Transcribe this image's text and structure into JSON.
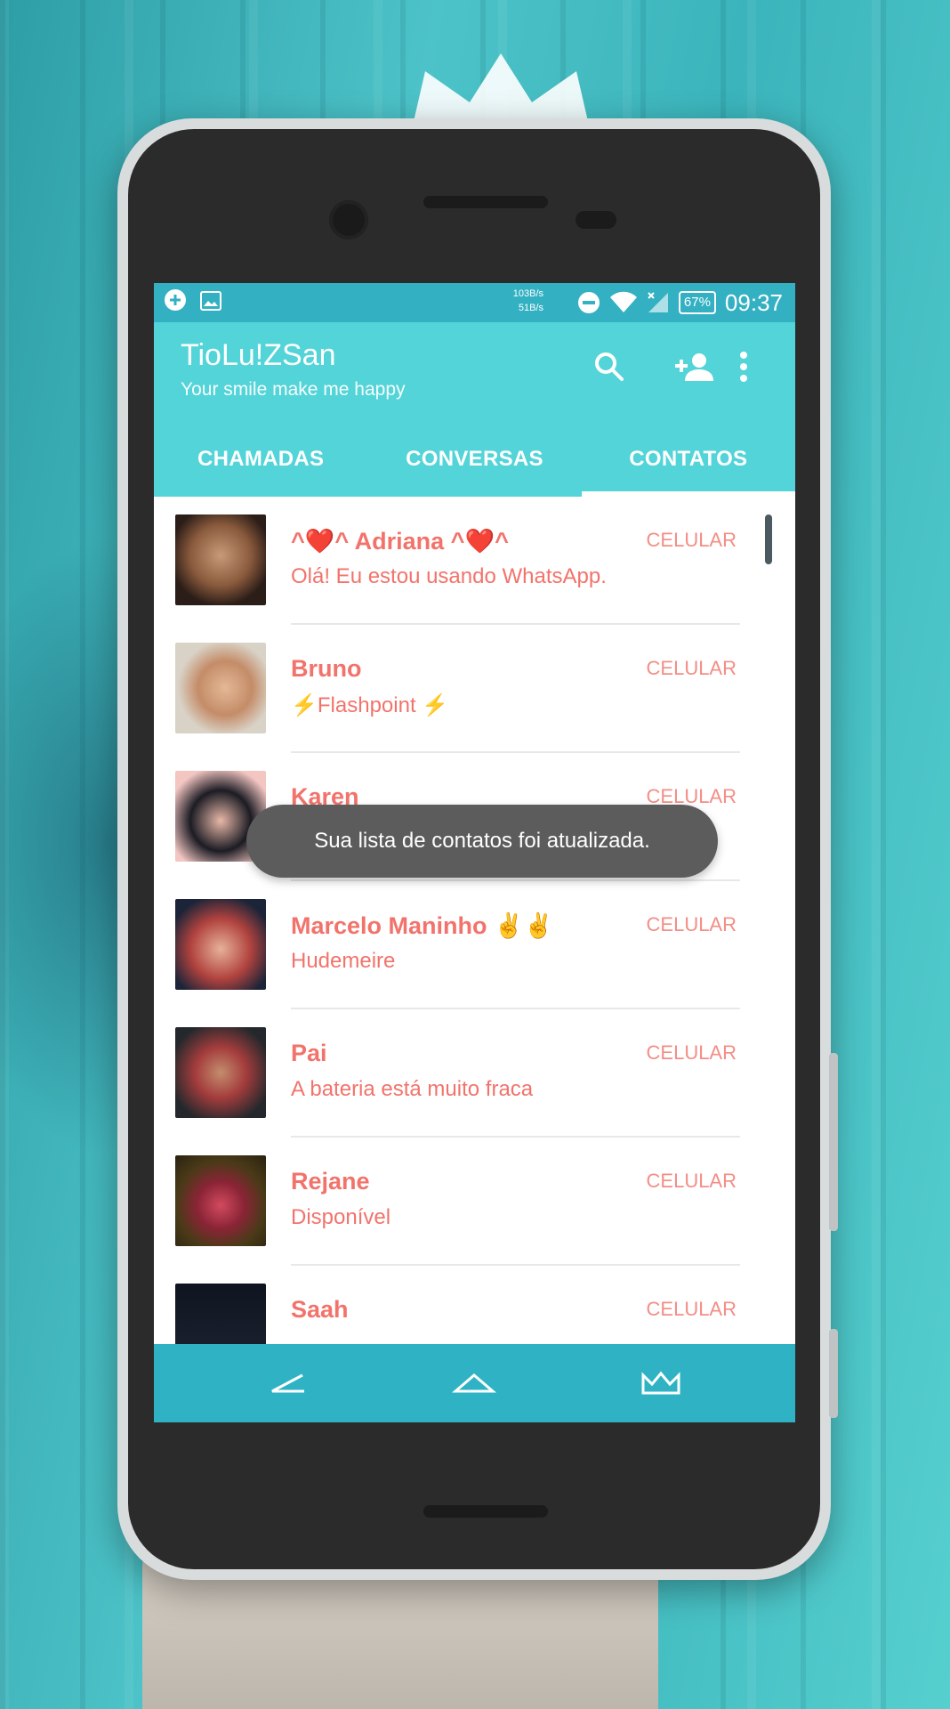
{
  "status_bar": {
    "speed_up": "103B/s",
    "speed_down": "51B/s",
    "battery": "67%",
    "time": "09:37"
  },
  "header": {
    "title": "TioLu!ZSan",
    "subtitle": "Your smile make me happy",
    "icons": [
      "search-icon",
      "add-contact-icon",
      "more-vert-icon"
    ]
  },
  "tabs": [
    {
      "label": "CHAMADAS",
      "active": false
    },
    {
      "label": "CONVERSAS",
      "active": false
    },
    {
      "label": "CONTATOS",
      "active": true
    }
  ],
  "contacts": [
    {
      "name": "^❤️^ Adriana ^❤️^",
      "status": "Olá! Eu estou usando WhatsApp.",
      "type": "CELULAR"
    },
    {
      "name": "Bruno",
      "status": "⚡Flashpoint ⚡",
      "type": "CELULAR"
    },
    {
      "name": "Karen",
      "status": "",
      "type": "CELULAR"
    },
    {
      "name": "Marcelo Maninho ✌️✌️",
      "status": "Hudemeire",
      "type": "CELULAR"
    },
    {
      "name": "Pai",
      "status": "A bateria está muito fraca",
      "type": "CELULAR"
    },
    {
      "name": "Rejane",
      "status": "Disponível",
      "type": "CELULAR"
    },
    {
      "name": "Saah",
      "status": "",
      "type": "CELULAR"
    }
  ],
  "toast": {
    "message": "Sua lista de contatos foi atualizada."
  },
  "nav": {
    "icons": [
      "back-icon",
      "home-icon",
      "crown-icon"
    ]
  },
  "colors": {
    "accent": "#53d4d8",
    "status_bar": "#33b1c3",
    "nav_bar": "#2fb3c4",
    "contact_text": "#f2736b"
  }
}
